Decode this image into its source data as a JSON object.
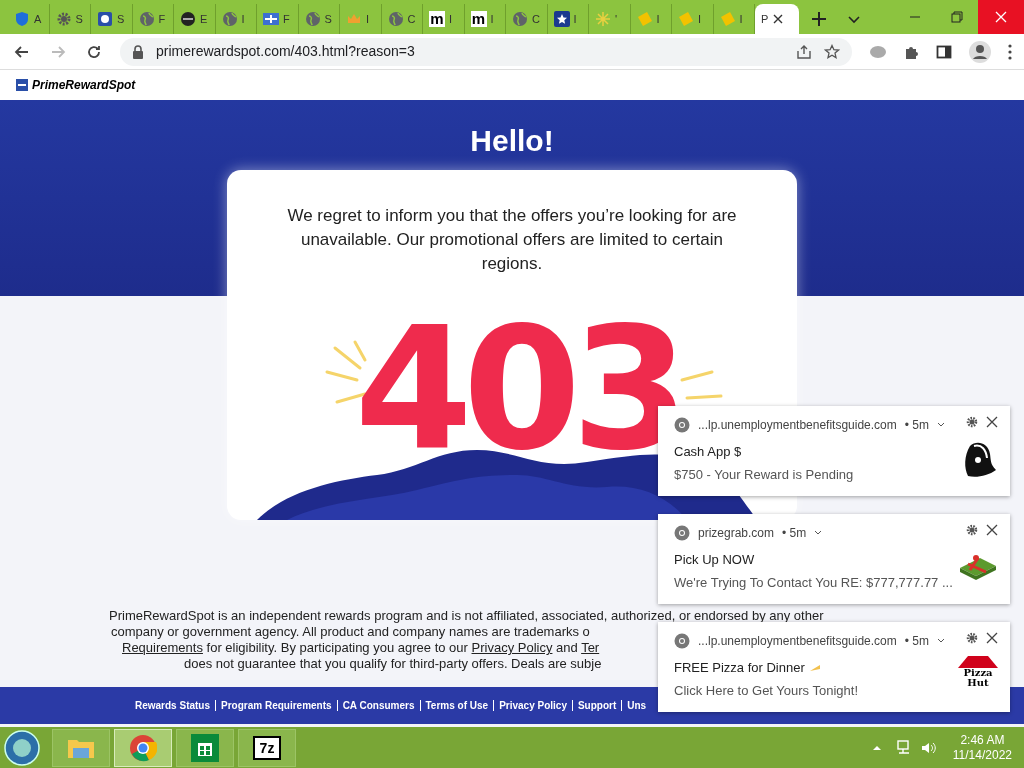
{
  "tabs": [
    {
      "kind": "shield",
      "label": "A",
      "selected": false
    },
    {
      "kind": "gear",
      "label": "S",
      "selected": false
    },
    {
      "kind": "badge",
      "label": "S",
      "selected": false
    },
    {
      "kind": "globe",
      "label": "F",
      "selected": false
    },
    {
      "kind": "dark",
      "label": "E",
      "selected": false
    },
    {
      "kind": "globe",
      "label": "I",
      "selected": false
    },
    {
      "kind": "flag",
      "label": "F",
      "selected": false
    },
    {
      "kind": "globe",
      "label": "S",
      "selected": false
    },
    {
      "kind": "crown",
      "label": "I",
      "selected": false
    },
    {
      "kind": "globe",
      "label": "C",
      "selected": false
    },
    {
      "kind": "letter",
      "icon_text": "m",
      "label": "I",
      "selected": false
    },
    {
      "kind": "letter",
      "icon_text": "m",
      "label": "I",
      "selected": false
    },
    {
      "kind": "globe",
      "label": "C",
      "selected": false
    },
    {
      "kind": "star",
      "label": "I",
      "selected": false
    },
    {
      "kind": "sparkle",
      "label": "'",
      "selected": false
    },
    {
      "kind": "free",
      "label": "I",
      "selected": false
    },
    {
      "kind": "free",
      "label": "I",
      "selected": false
    },
    {
      "kind": "free",
      "label": "I",
      "selected": false
    },
    {
      "kind": "none",
      "label": "P",
      "selected": true
    }
  ],
  "address_bar": {
    "url": "primerewardspot.com/403.html?reason=3",
    "forward_disabled": true
  },
  "bookmarks": [
    {
      "label": "PrimeRewardSpot"
    }
  ],
  "page": {
    "heading": "Hello!",
    "message": "We regret to inform you that the offers you’re looking for are unavailable. Our promotional offers are limited to certain regions.",
    "error_code": "403",
    "disclaimer_lines": [
      [
        {
          "text": "PrimeRewardSpot is an independent rewards program and is not affiliated, associated, authorized, or endorsed by any other",
          "link": false
        }
      ],
      [
        {
          "text": "company or government agency. All product and company names are trademarks o",
          "link": false
        }
      ],
      [
        {
          "text": "Requirements",
          "link": true
        },
        {
          "text": " for eligibility. By participating you agree to our ",
          "link": false
        },
        {
          "text": "Privacy Policy",
          "link": true
        },
        {
          "text": " and ",
          "link": false
        },
        {
          "text": "Ter",
          "link": true
        }
      ],
      [
        {
          "text": "does not guarantee that you qualify for third-party offers. Deals are subje",
          "link": false
        }
      ]
    ],
    "footer_links": [
      "Rewards Status",
      "Program Requirements",
      "CA Consumers",
      "Terms of Use",
      "Privacy Policy",
      "Support",
      "Uns"
    ]
  },
  "notifications": [
    {
      "kind": "bell",
      "source": "...lp.unemploymentbenefitsguide.com",
      "age": "• 5m",
      "title": "Cash App $",
      "body": "$750 - Your Reward is Pending"
    },
    {
      "kind": "gift",
      "source": "prizegrab.com",
      "age": "• 5m",
      "title": "Pick Up NOW",
      "body": "We're Trying To Contact You RE: $777,777.77 ..."
    },
    {
      "kind": "pizza",
      "source": "...lp.unemploymentbenefitsguide.com",
      "age": "• 5m",
      "title": "FREE Pizza for Dinner",
      "body": "Click Here to Get Yours Tonight!",
      "image_text": [
        "Pizza",
        "Hut"
      ]
    }
  ],
  "taskbar": {
    "apps": [
      {
        "kind": "explorer",
        "selected": false
      },
      {
        "kind": "chrome",
        "selected": true
      },
      {
        "kind": "store",
        "selected": false
      },
      {
        "kind": "sevenzip",
        "label": "7z",
        "selected": false
      }
    ],
    "time": "2:46 AM",
    "date": "11/14/2022"
  }
}
